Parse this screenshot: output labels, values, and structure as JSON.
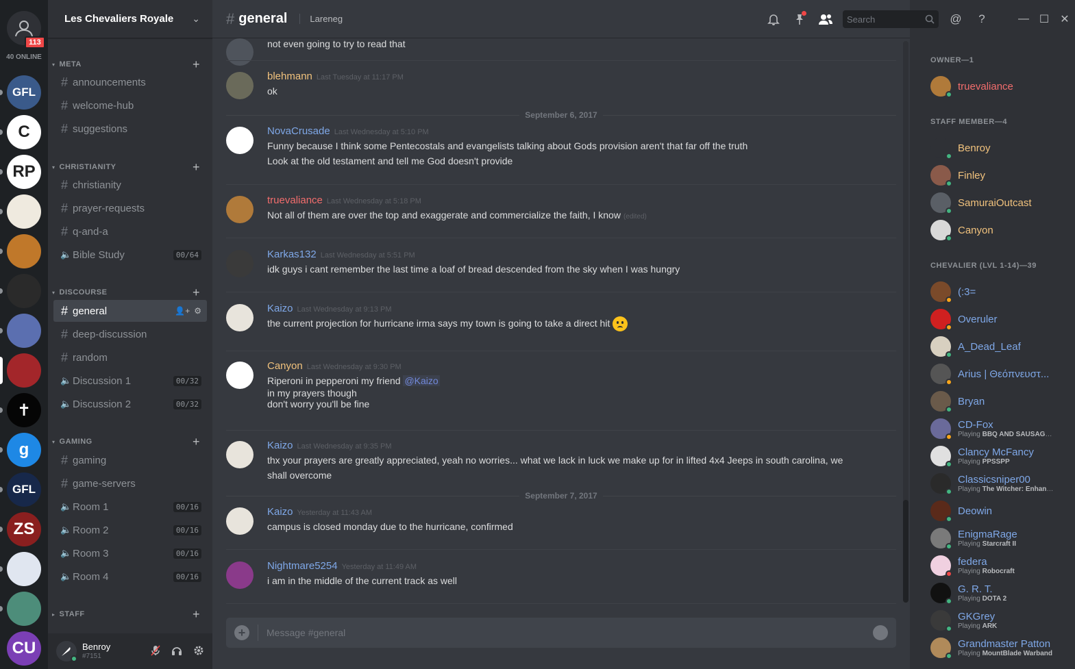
{
  "colors": {
    "owner": "#f26d6d",
    "staff": "#f1c27d",
    "chevalier": "#7fa8e8",
    "default_user": "#a9c5ef",
    "online": "#43b581",
    "idle": "#faa61a",
    "dnd": "#f04747"
  },
  "rail": {
    "unread_count": "113",
    "online_label": "40 ONLINE",
    "servers": [
      {
        "label": "GFL",
        "color": "#3a5a8a"
      },
      {
        "label": "C",
        "color": "#ffffff"
      },
      {
        "label": "RP",
        "color": "#ffffff"
      },
      {
        "label": "",
        "color": "#efeadf"
      },
      {
        "label": "",
        "color": "#c0782a"
      },
      {
        "label": "",
        "color": "#2a2a2a"
      },
      {
        "label": "",
        "color": "#5b6fb0"
      },
      {
        "label": "",
        "color": "#a3262a"
      },
      {
        "label": "✝",
        "color": "#050505"
      },
      {
        "label": "g",
        "color": "#1e88e5"
      },
      {
        "label": "GFL",
        "color": "#17284a"
      },
      {
        "label": "ZS",
        "color": "#8a1f1f"
      },
      {
        "label": "",
        "color": "#e0e6f0"
      },
      {
        "label": "",
        "color": "#4d8d7a"
      },
      {
        "label": "CU",
        "color": "#7b3fb5"
      }
    ]
  },
  "guild": {
    "name": "Les Chevaliers Royale",
    "categories": [
      {
        "name": "META",
        "channels": [
          {
            "type": "text",
            "name": "announcements"
          },
          {
            "type": "text",
            "name": "welcome-hub"
          },
          {
            "type": "text",
            "name": "suggestions"
          }
        ]
      },
      {
        "name": "CHRISTIANITY",
        "channels": [
          {
            "type": "text",
            "name": "christianity"
          },
          {
            "type": "text",
            "name": "prayer-requests"
          },
          {
            "type": "text",
            "name": "q-and-a"
          },
          {
            "type": "voice",
            "name": "Bible Study",
            "count": "00/64"
          }
        ]
      },
      {
        "name": "DISCOURSE",
        "channels": [
          {
            "type": "text",
            "name": "general",
            "active": true
          },
          {
            "type": "text",
            "name": "deep-discussion"
          },
          {
            "type": "text",
            "name": "random"
          },
          {
            "type": "voice",
            "name": "Discussion 1",
            "count": "00/32"
          },
          {
            "type": "voice",
            "name": "Discussion 2",
            "count": "00/32"
          }
        ]
      },
      {
        "name": "GAMING",
        "channels": [
          {
            "type": "text",
            "name": "gaming"
          },
          {
            "type": "text",
            "name": "game-servers"
          },
          {
            "type": "voice",
            "name": "Room 1",
            "count": "00/16"
          },
          {
            "type": "voice",
            "name": "Room 2",
            "count": "00/16"
          },
          {
            "type": "voice",
            "name": "Room 3",
            "count": "00/16"
          },
          {
            "type": "voice",
            "name": "Room 4",
            "count": "00/16"
          }
        ]
      },
      {
        "name": "STAFF",
        "channels": [],
        "collapsed": true
      }
    ]
  },
  "user": {
    "name": "Benroy",
    "tag": "#7151"
  },
  "chat": {
    "channel": "general",
    "topic": "Lareneg",
    "search_placeholder": "Search",
    "composer_placeholder": "Message #general",
    "items": [
      {
        "kind": "msg",
        "author": "",
        "role": "chevalier",
        "time": "",
        "lines": [
          "not even going to try to read that"
        ],
        "partial": true
      },
      {
        "kind": "sep"
      },
      {
        "kind": "msg",
        "author": "blehmann",
        "role": "staff",
        "time": "Last Tuesday at 11:17 PM",
        "lines": [
          "ok"
        ],
        "avatar_color": "#6a6a5a"
      },
      {
        "kind": "date",
        "text": "September 6, 2017"
      },
      {
        "kind": "msg",
        "author": "NovaCrusade",
        "role": "chevalier",
        "time": "Last Wednesday at 5:10 PM",
        "lines": [
          "Funny because I think some Pentecostals and evangelists talking about Gods provision aren't that far off the truth",
          "Look at the old testament and tell me God doesn't provide"
        ],
        "avatar_color": "#ffffff"
      },
      {
        "kind": "sep"
      },
      {
        "kind": "msg",
        "author": "truevaliance",
        "role": "owner",
        "time": "Last Wednesday at 5:18 PM",
        "lines": [
          "Not all of them are over the top and exaggerate and commercialize the faith, I know"
        ],
        "edited": "(edited)",
        "avatar_color": "#b07a3a"
      },
      {
        "kind": "sep"
      },
      {
        "kind": "msg",
        "author": "Karkas132",
        "role": "chevalier",
        "time": "Last Wednesday at 5:51 PM",
        "lines": [
          "idk guys i cant remember the last time a loaf of bread descended from the sky when I was hungry"
        ],
        "avatar_color": "#3a3a3a"
      },
      {
        "kind": "sep"
      },
      {
        "kind": "msg",
        "author": "Kaizo",
        "role": "chevalier",
        "time": "Last Wednesday at 9:13 PM",
        "lines": [
          "the current projection for hurricane irma says my town is going to take a direct hit"
        ],
        "emoji": true,
        "avatar_color": "#e8e4dc"
      },
      {
        "kind": "sep"
      },
      {
        "kind": "msg",
        "author": "Canyon",
        "role": "staff",
        "time": "Last Wednesday at 9:30 PM",
        "lines": [
          "Riperoni in pepperoni my friend",
          "in my prayers though",
          "don't worry you'll be fine"
        ],
        "mention": "@Kaizo",
        "avatar_color": "#ffffff"
      },
      {
        "kind": "sep"
      },
      {
        "kind": "msg",
        "author": "Kaizo",
        "role": "chevalier",
        "time": "Last Wednesday at 9:35 PM",
        "lines": [
          "thx your prayers are greatly appreciated, yeah no worries... what we lack in luck we make up for in lifted 4x4 Jeeps in south carolina, we",
          "shall overcome"
        ],
        "avatar_color": "#e8e4dc"
      },
      {
        "kind": "date",
        "text": "September 7, 2017"
      },
      {
        "kind": "msg",
        "author": "Kaizo",
        "role": "chevalier",
        "time": "Yesterday at 11:43 AM",
        "lines": [
          "campus is closed monday due to the hurricane, confirmed"
        ],
        "avatar_color": "#e8e4dc"
      },
      {
        "kind": "sep"
      },
      {
        "kind": "msg",
        "author": "Nightmare5254",
        "role": "chevalier",
        "time": "Yesterday at 11:49 AM",
        "lines": [
          "i am in the middle of the current track as well"
        ],
        "avatar_color": "#8a3a8a"
      },
      {
        "kind": "sep"
      }
    ]
  },
  "members": {
    "groups": [
      {
        "title": "OWNER—1",
        "role": "owner",
        "items": [
          {
            "name": "truevaliance",
            "status": "online",
            "color": "#b07a3a"
          }
        ]
      },
      {
        "title": "STAFF MEMBER—4",
        "role": "staff",
        "items": [
          {
            "name": "Benroy",
            "status": "online",
            "color": "#2f3136"
          },
          {
            "name": "Finley",
            "status": "online",
            "color": "#8a5a4a"
          },
          {
            "name": "SamuraiOutcast",
            "status": "online",
            "color": "#5a5f66"
          },
          {
            "name": "Canyon",
            "status": "online",
            "color": "#d8d8d8"
          }
        ]
      },
      {
        "title": "CHEVALIER (LVL 1-14)—39",
        "role": "chevalier",
        "items": [
          {
            "name": "(:3=",
            "status": "idle",
            "color": "#7a4a2a"
          },
          {
            "name": "Overuler",
            "status": "idle",
            "color": "#d02020"
          },
          {
            "name": "A_Dead_Leaf",
            "status": "online",
            "color": "#d8d0c0"
          },
          {
            "name": "Arius | Θεόπνευστ...",
            "status": "idle",
            "color": "#555555"
          },
          {
            "name": "Bryan",
            "status": "online",
            "color": "#6a5a4a"
          },
          {
            "name": "CD-Fox",
            "status": "idle",
            "color": "#6a6a9a",
            "activity": "BBQ AND SAUSAGE..."
          },
          {
            "name": "Clancy McFancy",
            "status": "online",
            "color": "#e0e0e0",
            "activity": "PPSSPP"
          },
          {
            "name": "Classicsniper00",
            "status": "online",
            "color": "#2a2a2a",
            "activity": "The Witcher: Enhanc..."
          },
          {
            "name": "Deowin",
            "status": "online",
            "color": "#5a2a1a"
          },
          {
            "name": "EnigmaRage",
            "status": "online",
            "color": "#7a7a7a",
            "activity": "Starcraft II"
          },
          {
            "name": "federa",
            "status": "dnd",
            "color": "#f0d0e0",
            "activity": "Robocraft"
          },
          {
            "name": "G. R. T.",
            "status": "online",
            "color": "#111111",
            "activity": "DOTA 2"
          },
          {
            "name": "GKGrey",
            "status": "online",
            "color": "#3a3a3a",
            "activity": "ARK"
          },
          {
            "name": "Grandmaster Patton",
            "status": "online",
            "color": "#b08a5a",
            "activity": "MountBlade Warband"
          }
        ]
      }
    ],
    "playing_label": "Playing"
  }
}
